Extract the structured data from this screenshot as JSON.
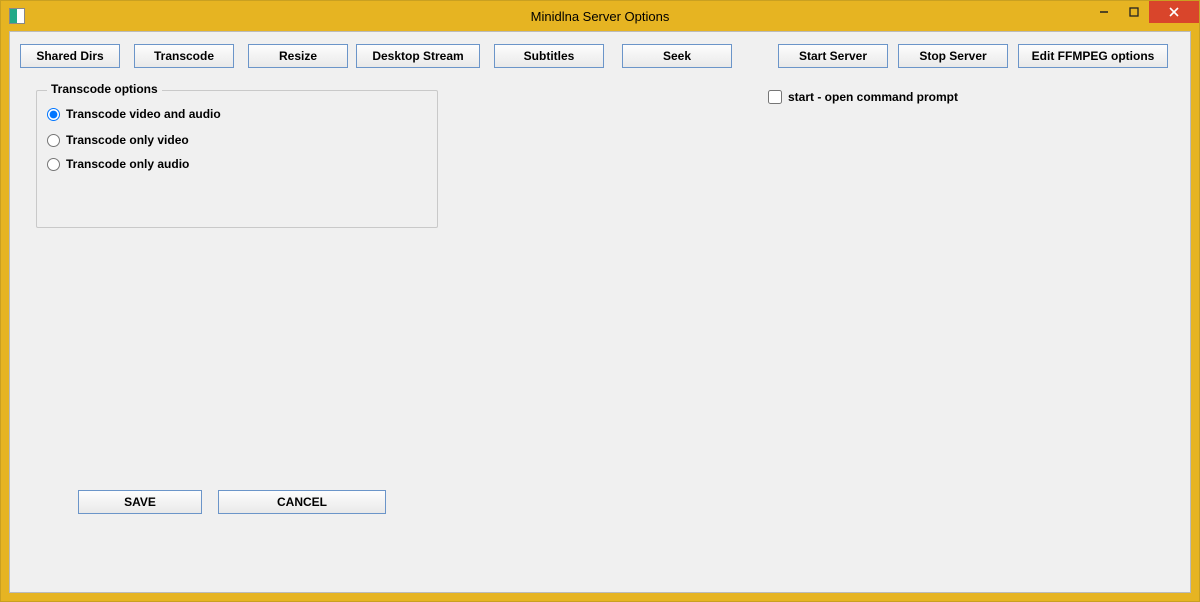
{
  "window": {
    "title": "Minidlna Server Options"
  },
  "toolbar": {
    "shared_dirs": "Shared Dirs",
    "transcode": "Transcode",
    "resize": "Resize",
    "desktop_stream": "Desktop Stream",
    "subtitles": "Subtitles",
    "seek": "Seek",
    "start_server": "Start Server",
    "stop_server": "Stop Server",
    "edit_ffmpeg": "Edit FFMPEG options"
  },
  "transcode_group": {
    "legend": "Transcode options",
    "opt_va": "Transcode video and audio",
    "opt_v": "Transcode only video",
    "opt_a": "Transcode only audio"
  },
  "start_checkbox": "start - open command prompt",
  "actions": {
    "save": "SAVE",
    "cancel": "CANCEL"
  }
}
